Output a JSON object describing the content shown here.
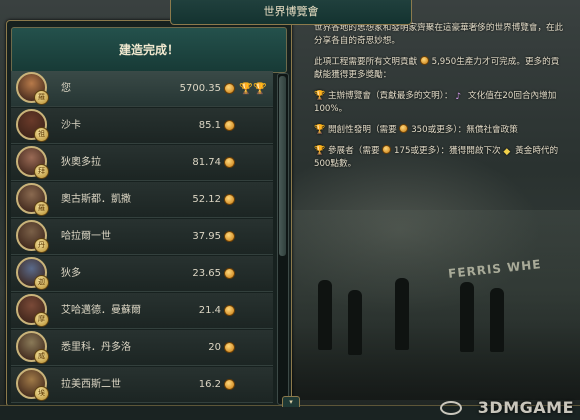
{
  "title": "世界博覽會",
  "left_header": "建造完成！",
  "rankings": [
    {
      "name": "您",
      "score": "5700.35",
      "badge": "羅",
      "avatar_color": "#b77a4a",
      "highlight": true,
      "trophies": [
        "gold",
        "silver"
      ]
    },
    {
      "name": "沙卡",
      "score": "85.1",
      "badge": "祖",
      "avatar_color": "#6a3a2a",
      "highlight": false,
      "trophies": []
    },
    {
      "name": "狄奧多拉",
      "score": "81.74",
      "badge": "拜",
      "avatar_color": "#9a6a55",
      "highlight": false,
      "trophies": []
    },
    {
      "name": "奧古斯都．凱撒",
      "score": "52.12",
      "badge": "羅",
      "avatar_color": "#8a6a50",
      "highlight": false,
      "trophies": []
    },
    {
      "name": "哈拉爾一世",
      "score": "37.95",
      "badge": "丹",
      "avatar_color": "#7a6048",
      "highlight": false,
      "trophies": []
    },
    {
      "name": "狄多",
      "score": "23.65",
      "badge": "迦",
      "avatar_color": "#5a6a8a",
      "highlight": false,
      "trophies": []
    },
    {
      "name": "艾哈邁德．曼蘇爾",
      "score": "21.4",
      "badge": "摩",
      "avatar_color": "#7a4a38",
      "highlight": false,
      "trophies": []
    },
    {
      "name": "悉里科．丹多洛",
      "score": "20",
      "badge": "威",
      "avatar_color": "#8a7a58",
      "highlight": false,
      "trophies": []
    },
    {
      "name": "拉美西斯二世",
      "score": "16.2",
      "badge": "埃",
      "avatar_color": "#a07a48",
      "highlight": false,
      "trophies": []
    }
  ],
  "description": {
    "intro": "世界各地的思想家和發明家齊聚在這豪華奢侈的世界博覽會，在此分享各自的奇思妙想。",
    "requirement_prefix": "此項工程需要所有文明貢獻",
    "requirement_amount": "5,950生產力才可完成。更多的貢獻能獲得更多獎勵：",
    "reward_1_label": "主辦博覽會",
    "reward_1_cond": "（貢獻最多的文明）：",
    "reward_1_effect": "文化值在20回合內增加100%。",
    "reward_2_label": "開創性發明",
    "reward_2_cond": "（需要",
    "reward_2_cond2": "350或更多）：無償社會政策",
    "reward_3_label": "參展者",
    "reward_3_cond": "（需要",
    "reward_3_cond2": "175或更多）：獲得開啟下次",
    "reward_3_effect": "黃金時代的500點數。"
  },
  "scene_sign": "FERRIS WHE",
  "close_label": "▾",
  "watermark": "3DMGAME"
}
